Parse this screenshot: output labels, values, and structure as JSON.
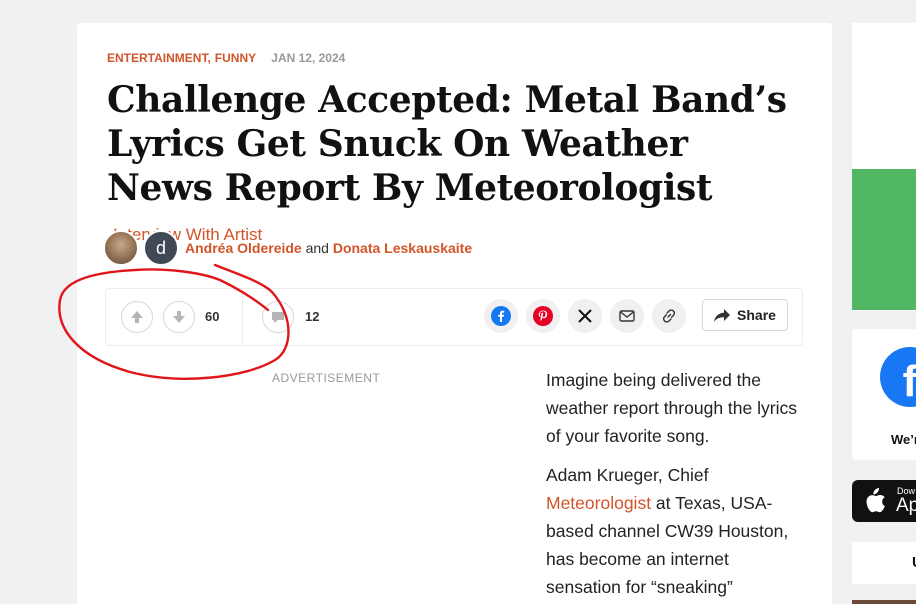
{
  "article": {
    "categories": [
      "Entertainment",
      "Funny"
    ],
    "category_separator": ",",
    "date": "Jan 12, 2024",
    "title": "Challenge Accepted: Metal Band’s Lyrics Get Snuck On Weather News Report By Meteorologist",
    "title_tag": "Interview With Artist",
    "authors": {
      "avatar_letter": "d",
      "first": "Andréa Oldereide",
      "conjunction": "and",
      "second": "Donata Leskauskaite"
    }
  },
  "actions": {
    "vote_count": "60",
    "comment_count": "12",
    "share_label": "Share",
    "share_icons": [
      "facebook-icon",
      "pinterest-icon",
      "x-icon",
      "mail-icon",
      "link-icon"
    ]
  },
  "ad_label": "Advertisement",
  "body": {
    "p1": "Imagine being delivered the weather report through the lyrics of your favorite song.",
    "p2_before": "Adam Krueger, Chief ",
    "p2_link": "Meteorologist",
    "p2_after": " at Texas, USA-based channel CW39 Houston, has become an internet sensation for “sneaking”"
  },
  "sidebar": {
    "facebook_letter": "f",
    "were_text": "We’r",
    "app_small": "Dow",
    "app_big": "Ap",
    "card3_text": "U"
  },
  "colors": {
    "accent": "#d2542a",
    "annotation": "#e0161b",
    "facebook": "#1877f2",
    "pinterest": "#e60023",
    "green_ad": "#52b762"
  }
}
